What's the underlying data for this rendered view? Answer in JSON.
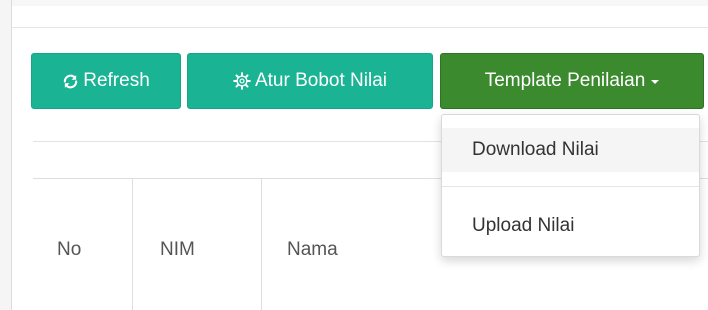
{
  "toolbar": {
    "refresh_label": "Refresh",
    "refresh_icon": "refresh-icon",
    "bobot_label": "Atur Bobot Nilai",
    "bobot_icon": "gear-icon",
    "template_label": "Template Penilaian",
    "template_icon": "caret-down-icon"
  },
  "dropdown": {
    "items": [
      {
        "label": "Download Nilai"
      },
      {
        "label": "Upload Nilai"
      }
    ]
  },
  "table": {
    "columns": [
      "No",
      "NIM",
      "Nama"
    ]
  },
  "colors": {
    "primary_button": "#1ab394",
    "success_button": "#3c8a2e",
    "dropdown_hover": "#f5f5f5"
  }
}
